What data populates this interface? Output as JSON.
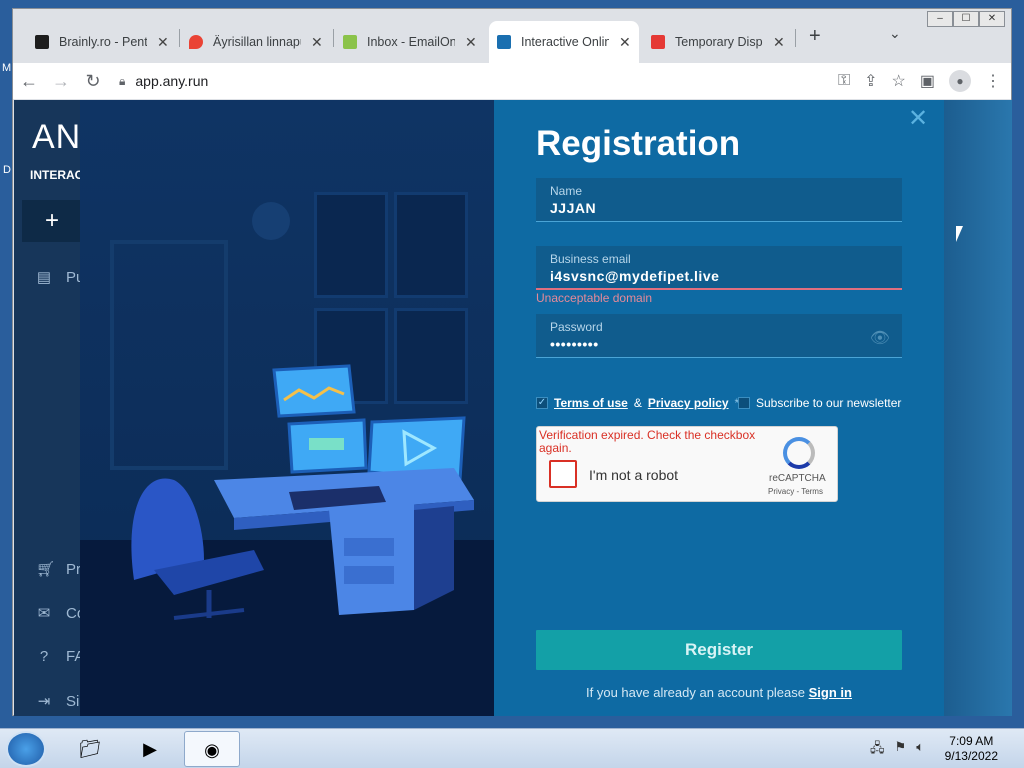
{
  "browser": {
    "tabs": [
      {
        "title": "Brainly.ro - Pentru",
        "favicon_color": "#1d1d1d",
        "active": false
      },
      {
        "title": "Äyrisillan linnapuis",
        "favicon_color": "#ea4335",
        "active": false
      },
      {
        "title": "Inbox - EmailOnDe",
        "favicon_color": "#8bc34a",
        "active": false
      },
      {
        "title": "Interactive Online M",
        "favicon_color": "#1a6fb0",
        "active": true
      },
      {
        "title": "Temporary Dispos",
        "favicon_color": "#e53935",
        "active": false
      }
    ],
    "new_tab": "+",
    "tab_menu": "⌄",
    "address": "app.any.run",
    "window_buttons": [
      "‒",
      "☐",
      "✕"
    ]
  },
  "app": {
    "logo": "ANY",
    "logo_sub": "INTERACTIV",
    "new_button": "+",
    "sidebar_items": [
      {
        "icon": "document-icon",
        "label": "Pu"
      },
      {
        "icon": "cart-icon",
        "label": "Pr"
      },
      {
        "icon": "mail-icon",
        "label": "Co"
      },
      {
        "icon": "help-icon",
        "label": "FA"
      },
      {
        "icon": "signin-icon",
        "label": "Sig"
      }
    ]
  },
  "registration": {
    "title": "Registration",
    "close": "✕",
    "fields": {
      "name": {
        "label": "Name",
        "value": "JJJAN"
      },
      "email": {
        "label": "Business email",
        "value": "i4svsnc@mydefipet.live",
        "error": "Unacceptable domain"
      },
      "password": {
        "label": "Password",
        "value": "•••••••••"
      }
    },
    "terms": {
      "checked": true,
      "terms_of_use": "Terms of use",
      "and": "&",
      "privacy_policy": "Privacy policy",
      "required_mark": "*"
    },
    "newsletter": {
      "checked": false,
      "label": "Subscribe to our newsletter"
    },
    "captcha": {
      "error": "Verification expired. Check the checkbox again.",
      "label": "I'm not a robot",
      "brand": "reCAPTCHA",
      "links": "Privacy - Terms"
    },
    "register_button": "Register",
    "signin_text": "If you have already an account please",
    "signin_link": "Sign in"
  },
  "taskbar": {
    "time": "7:09 AM",
    "date": "9/13/2022"
  },
  "colors": {
    "modal_bg": "#0e6aa3",
    "register_button": "#13a0a7",
    "error": "#e58a99"
  }
}
